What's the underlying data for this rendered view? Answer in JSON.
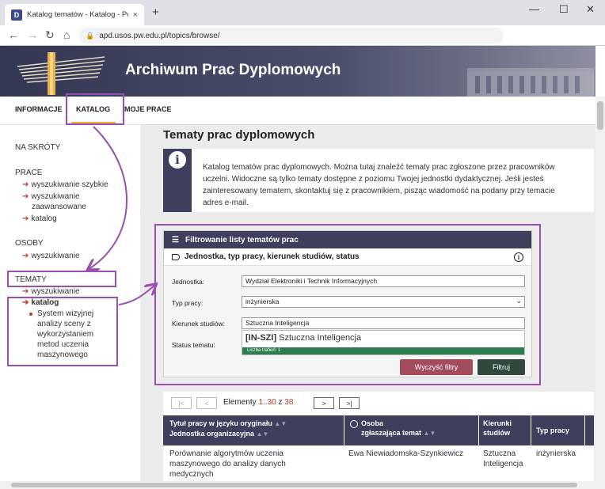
{
  "browser": {
    "tab_title": "Katalog tematów - Katalog - Pol",
    "url": "apd.usos.pw.edu.pl/topics/browse/",
    "favicon_letter": "D"
  },
  "banner": {
    "title": "Archiwum Prac Dyplomowych"
  },
  "topnav": {
    "items": [
      "INFORMACJE",
      "KATALOG",
      "MOJE PRACE"
    ]
  },
  "sidebar": {
    "shortcuts": "NA SKRÓTY",
    "prace_heading": "PRACE",
    "prace_links": [
      "wyszukiwanie szybkie",
      "wyszukiwanie",
      "zaawansowane",
      "katalog"
    ],
    "osoby_heading": "OSOBY",
    "osoby_links": [
      "wyszukiwanie"
    ],
    "tematy_heading": "TEMATY",
    "tematy_links": [
      "wyszukiwanie",
      "katalog"
    ],
    "tematy_sub": [
      "System wizyjnej",
      "analizy sceny z",
      "wykorzystaniem",
      "metod uczenia",
      "maszynowego"
    ]
  },
  "main": {
    "title": "Tematy prac dyplomowych",
    "info_lines": [
      "Katalog tematów prac dyplomowych. Można tutaj znaleźć tematy prac zgłoszone przez pracowników",
      "uczelni. Widoczne są tylko tematy dostępne z poziomu Twojej jednostki dydaktycznej. Jeśli jesteś",
      "zainteresowany tematem, skontaktuj się z pracownikiem, pisząc wiadomość na podany przy temacie",
      "adres e-mail."
    ]
  },
  "filter": {
    "header": "Filtrowanie listy tematów prac",
    "subheader": "Jednostka, typ pracy, kierunek studiów, status",
    "jednostka_label": "Jednostka:",
    "jednostka_value": "Wydział Elektroniki i Technik Informacyjnych",
    "typ_label": "Typ pracy:",
    "typ_value": "inżynierska",
    "kierunek_label": "Kierunek studiów:",
    "kierunek_value": "Sztuczna Inteligencja",
    "status_label": "Status tematu:",
    "suggestion_code": "[IN-SZI]",
    "suggestion_name": " Sztuczna Inteligencja",
    "suggestion_count": "Liczba trafień: 1",
    "clear_button": "Wyczyść filtry",
    "filter_button": "Filtruj"
  },
  "pager": {
    "first": "|<",
    "prev": "<",
    "label": "Elementy",
    "range": "1..30",
    "of": "z",
    "total": "38",
    "next": ">",
    "last": ">|"
  },
  "table": {
    "headers": {
      "title": [
        "Tytuł pracy w języku oryginału",
        "Jednostka organizacyjna"
      ],
      "person": [
        "Osoba",
        "zgłaszająca temat"
      ],
      "kierunki": [
        "Kierunki",
        "studiów"
      ],
      "typ": "Typ pracy"
    },
    "rows": [
      {
        "title": [
          "Porównanie algorytmów uczenia",
          "maszynowego do analizy danych",
          "medycznych"
        ],
        "person": "Ewa Niewiadomska-Szynkiewicz",
        "kierunki": [
          "Sztuczna",
          "Inteligencja"
        ],
        "typ": "inżynierska"
      }
    ]
  },
  "colors": {
    "accent_purple": "#9b4fb0",
    "header_dark": "#3e3f5c",
    "link_arrow": "#c0392b",
    "active_underline": "#f2b135"
  }
}
